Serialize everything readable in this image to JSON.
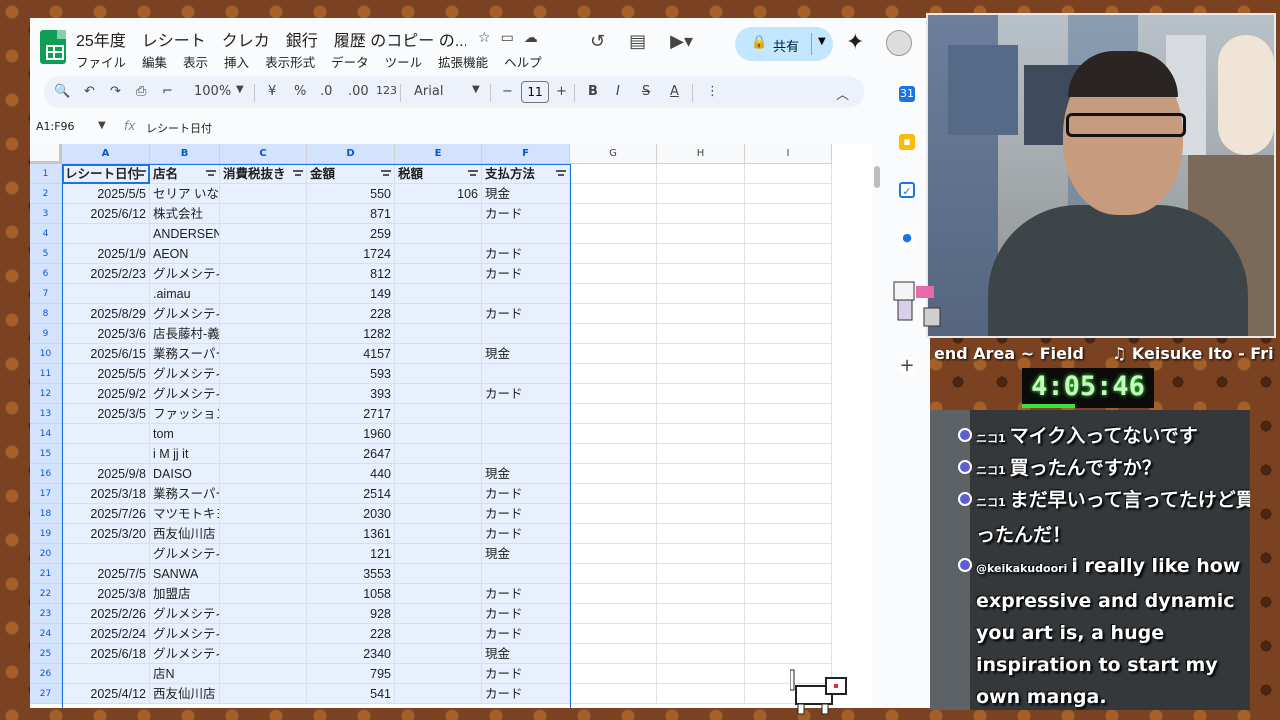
{
  "doc": {
    "title": "25年度　レシート　クレカ　銀行　履歴 のコピー の...",
    "menu": [
      "ファイル",
      "編集",
      "表示",
      "挿入",
      "表示形式",
      "データ",
      "ツール",
      "拡張機能",
      "ヘルプ"
    ],
    "share_label": "共有"
  },
  "toolbar": {
    "zoom": "100%",
    "currency": "¥",
    "percent": "%",
    "dec_decrease": ".0",
    "dec_increase": ".00",
    "number_format": "123",
    "font": "Arial",
    "font_size": "11"
  },
  "formula": {
    "namebox": "A1:F96",
    "fx": "fx",
    "content": "レシート日付"
  },
  "columns": [
    "A",
    "B",
    "C",
    "D",
    "E",
    "F",
    "G",
    "H",
    "I"
  ],
  "header_row": {
    "num": "1",
    "a": "レシート日付",
    "b": "店名",
    "c": "消費税抜き",
    "d": "金額",
    "e": "税額",
    "f": "支払方法"
  },
  "rows": [
    {
      "num": "2",
      "a": "2025/5/5",
      "b": "セリア いなげや調布仙川店",
      "c": "",
      "d": "550",
      "e": "106",
      "f": "現金"
    },
    {
      "num": "3",
      "a": "2025/6/12",
      "b": "株式会社",
      "c": "",
      "d": "871",
      "e": "",
      "f": "カード"
    },
    {
      "num": "4",
      "a": "",
      "b": "ANDERSEN",
      "c": "",
      "d": "259",
      "e": "",
      "f": ""
    },
    {
      "num": "5",
      "a": "2025/1/9",
      "b": "AEON",
      "c": "",
      "d": "1724",
      "e": "",
      "f": "カード"
    },
    {
      "num": "6",
      "a": "2025/2/23",
      "b": "グルメシティ関東 三鷹中原",
      "c": "",
      "d": "812",
      "e": "",
      "f": "カード"
    },
    {
      "num": "7",
      "a": "",
      "b": ".aimau",
      "c": "",
      "d": "149",
      "e": "",
      "f": ""
    },
    {
      "num": "8",
      "a": "2025/8/29",
      "b": "グルメシティ関東 三鷹中原",
      "c": "",
      "d": "228",
      "e": "",
      "f": "カード"
    },
    {
      "num": "9",
      "a": "2025/3/6",
      "b": "店長藤村-義",
      "c": "",
      "d": "1282",
      "e": "",
      "f": ""
    },
    {
      "num": "10",
      "a": "2025/6/15",
      "b": "業務スーパー柴崎店",
      "c": "",
      "d": "4157",
      "e": "",
      "f": "現金"
    },
    {
      "num": "11",
      "a": "2025/5/5",
      "b": "グルメシティ関東 三鷹中原",
      "c": "",
      "d": "593",
      "e": "",
      "f": ""
    },
    {
      "num": "12",
      "a": "2025/9/2",
      "b": "グルメシティ関東 三鷹中原",
      "c": "",
      "d": "393",
      "e": "",
      "f": "カード"
    },
    {
      "num": "13",
      "a": "2025/3/5",
      "b": "ファッションセンターしまむら",
      "c": "",
      "d": "2717",
      "e": "",
      "f": ""
    },
    {
      "num": "14",
      "a": "",
      "b": "tom",
      "c": "",
      "d": "1960",
      "e": "",
      "f": ""
    },
    {
      "num": "15",
      "a": "",
      "b": "i M jj it",
      "c": "",
      "d": "2647",
      "e": "",
      "f": ""
    },
    {
      "num": "16",
      "a": "2025/9/8",
      "b": "DAISO",
      "c": "",
      "d": "440",
      "e": "",
      "f": "現金"
    },
    {
      "num": "17",
      "a": "2025/3/18",
      "b": "業務スーパー柴崎店",
      "c": "",
      "d": "2514",
      "e": "",
      "f": "カード"
    },
    {
      "num": "18",
      "a": "2025/7/26",
      "b": "マツモトキヨシ 三鷹新川店",
      "c": "",
      "d": "2030",
      "e": "",
      "f": "カード"
    },
    {
      "num": "19",
      "a": "2025/3/20",
      "b": "西友仙川店",
      "c": "",
      "d": "1361",
      "e": "",
      "f": "カード"
    },
    {
      "num": "20",
      "a": "",
      "b": "グルメシティ関東 三鷹中原",
      "c": "",
      "d": "121",
      "e": "",
      "f": "現金"
    },
    {
      "num": "21",
      "a": "2025/7/5",
      "b": "SANWA",
      "c": "",
      "d": "3553",
      "e": "",
      "f": ""
    },
    {
      "num": "22",
      "a": "2025/3/8",
      "b": "加盟店",
      "c": "",
      "d": "1058",
      "e": "",
      "f": "カード"
    },
    {
      "num": "23",
      "a": "2025/2/26",
      "b": "グルメシティ関東 三鷹中原",
      "c": "",
      "d": "928",
      "e": "",
      "f": "カード"
    },
    {
      "num": "24",
      "a": "2025/2/24",
      "b": "グルメシティ関東 三鷹中原",
      "c": "",
      "d": "228",
      "e": "",
      "f": "カード"
    },
    {
      "num": "25",
      "a": "2025/6/18",
      "b": "グルメシティ関東 三鷹中原",
      "c": "",
      "d": "2340",
      "e": "",
      "f": "現金"
    },
    {
      "num": "26",
      "a": "",
      "b": "店N",
      "c": "",
      "d": "795",
      "e": "",
      "f": "カード"
    },
    {
      "num": "27",
      "a": "2025/4/12",
      "b": "西友仙川店",
      "c": "",
      "d": "541",
      "e": "",
      "f": "カード"
    }
  ],
  "stream": {
    "scene_left": "end Area ~ Field",
    "scene_right": "♫ Keisuke Ito - Fri",
    "timer": "4:05:46",
    "timer_progress": 0.4,
    "chat": [
      {
        "name": "ニコ1",
        "text": "マイク入ってないです"
      },
      {
        "name": "ニコ1",
        "text": "買ったんですか？"
      },
      {
        "name": "ニコ1",
        "text": "まだ早いって言ってたけど買ったんだ！"
      },
      {
        "name": "@keikakudoori",
        "text": "i really like how expressive and dynamic you art is, a huge inspiration to start my own manga."
      }
    ]
  },
  "colors": {
    "accent": "#1a73e8",
    "selection": "#e8f0fe",
    "share_bg": "#c2e7ff",
    "timer_green": "#39e23a"
  }
}
